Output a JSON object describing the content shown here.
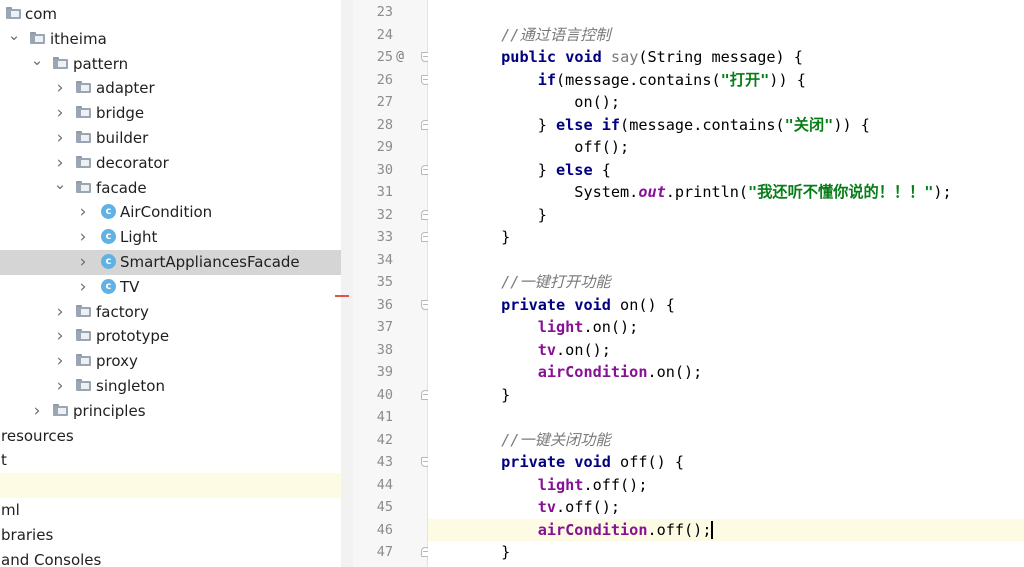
{
  "project_tree": {
    "items": [
      {
        "label": "com",
        "type": "folder",
        "expanded": true,
        "arrow": false,
        "indent": 0
      },
      {
        "label": "itheima",
        "type": "folder",
        "expanded": true,
        "arrow": true,
        "indent": 1
      },
      {
        "label": "pattern",
        "type": "folder",
        "expanded": true,
        "arrow": true,
        "indent": 2
      },
      {
        "label": "adapter",
        "type": "folder",
        "expanded": false,
        "arrow": true,
        "indent": 3
      },
      {
        "label": "bridge",
        "type": "folder",
        "expanded": false,
        "arrow": true,
        "indent": 3
      },
      {
        "label": "builder",
        "type": "folder",
        "expanded": false,
        "arrow": true,
        "indent": 3
      },
      {
        "label": "decorator",
        "type": "folder",
        "expanded": false,
        "arrow": true,
        "indent": 3
      },
      {
        "label": "facade",
        "type": "folder",
        "expanded": true,
        "arrow": true,
        "indent": 3
      },
      {
        "label": "AirCondition",
        "type": "class",
        "expanded": false,
        "arrow": true,
        "indent": 4
      },
      {
        "label": "Light",
        "type": "class",
        "expanded": false,
        "arrow": true,
        "indent": 4
      },
      {
        "label": "SmartAppliancesFacade",
        "type": "class",
        "expanded": false,
        "arrow": true,
        "indent": 4,
        "selected": true
      },
      {
        "label": "TV",
        "type": "class",
        "expanded": false,
        "arrow": true,
        "indent": 4
      },
      {
        "label": "factory",
        "type": "folder",
        "expanded": false,
        "arrow": true,
        "indent": 3
      },
      {
        "label": "prototype",
        "type": "folder",
        "expanded": false,
        "arrow": true,
        "indent": 3
      },
      {
        "label": "proxy",
        "type": "folder",
        "expanded": false,
        "arrow": true,
        "indent": 3
      },
      {
        "label": "singleton",
        "type": "folder",
        "expanded": false,
        "arrow": true,
        "indent": 3
      },
      {
        "label": "principles",
        "type": "folder",
        "expanded": false,
        "arrow": true,
        "indent": 2
      },
      {
        "label": "resources",
        "type": "text",
        "indent": -1
      },
      {
        "label": "t",
        "type": "text",
        "indent": -1
      },
      {
        "label": "",
        "type": "blank",
        "highlight": true
      },
      {
        "label": "ml",
        "type": "text",
        "indent": -1
      },
      {
        "label": "braries",
        "type": "text",
        "indent": -1
      },
      {
        "label": "and Consoles",
        "type": "text",
        "indent": -1
      }
    ],
    "class_icon_letter": "c",
    "selected_color": "#d5d5d5"
  },
  "editor": {
    "lines": [
      {
        "n": "23",
        "tokens": []
      },
      {
        "n": "24",
        "tokens": [
          {
            "t": "        "
          },
          {
            "t": "//通过语言控制",
            "c": "cm"
          }
        ]
      },
      {
        "n": "25",
        "mark": "@",
        "fold": "down",
        "tokens": [
          {
            "t": "        "
          },
          {
            "t": "public",
            "c": "kw"
          },
          {
            "t": " "
          },
          {
            "t": "void",
            "c": "kw"
          },
          {
            "t": " "
          },
          {
            "t": "say",
            "c": "mu"
          },
          {
            "t": "(String message) {"
          }
        ]
      },
      {
        "n": "26",
        "fold": "down",
        "tokens": [
          {
            "t": "            "
          },
          {
            "t": "if",
            "c": "kw"
          },
          {
            "t": "(message.contains("
          },
          {
            "t": "\"打开\"",
            "c": "st"
          },
          {
            "t": ")) {"
          }
        ]
      },
      {
        "n": "27",
        "tokens": [
          {
            "t": "                on();"
          }
        ]
      },
      {
        "n": "28",
        "fold": "up",
        "tokens": [
          {
            "t": "            } "
          },
          {
            "t": "else",
            "c": "kw"
          },
          {
            "t": " "
          },
          {
            "t": "if",
            "c": "kw"
          },
          {
            "t": "(message.contains("
          },
          {
            "t": "\"关闭\"",
            "c": "st"
          },
          {
            "t": ")) {"
          }
        ]
      },
      {
        "n": "29",
        "tokens": [
          {
            "t": "                off();"
          }
        ]
      },
      {
        "n": "30",
        "fold": "up",
        "tokens": [
          {
            "t": "            } "
          },
          {
            "t": "else",
            "c": "kw"
          },
          {
            "t": " {"
          }
        ]
      },
      {
        "n": "31",
        "tokens": [
          {
            "t": "                System."
          },
          {
            "t": "out",
            "c": "sf"
          },
          {
            "t": ".println("
          },
          {
            "t": "\"我还听不懂你说的！！！\"",
            "c": "st"
          },
          {
            "t": ");"
          }
        ]
      },
      {
        "n": "32",
        "fold": "up",
        "tokens": [
          {
            "t": "            }"
          }
        ]
      },
      {
        "n": "33",
        "fold": "up",
        "tokens": [
          {
            "t": "        }"
          }
        ]
      },
      {
        "n": "34",
        "tokens": []
      },
      {
        "n": "35",
        "tokens": [
          {
            "t": "        "
          },
          {
            "t": "//一键打开功能",
            "c": "cm"
          }
        ]
      },
      {
        "n": "36",
        "fold": "down",
        "tokens": [
          {
            "t": "        "
          },
          {
            "t": "private",
            "c": "kw"
          },
          {
            "t": " "
          },
          {
            "t": "void",
            "c": "kw"
          },
          {
            "t": " on() {"
          }
        ]
      },
      {
        "n": "37",
        "tokens": [
          {
            "t": "            "
          },
          {
            "t": "light",
            "c": "fd"
          },
          {
            "t": ".on();"
          }
        ]
      },
      {
        "n": "38",
        "tokens": [
          {
            "t": "            "
          },
          {
            "t": "tv",
            "c": "fd"
          },
          {
            "t": ".on();"
          }
        ]
      },
      {
        "n": "39",
        "tokens": [
          {
            "t": "            "
          },
          {
            "t": "airCondition",
            "c": "fd"
          },
          {
            "t": ".on();"
          }
        ]
      },
      {
        "n": "40",
        "fold": "up",
        "tokens": [
          {
            "t": "        }"
          }
        ]
      },
      {
        "n": "41",
        "tokens": []
      },
      {
        "n": "42",
        "tokens": [
          {
            "t": "        "
          },
          {
            "t": "//一键关闭功能",
            "c": "cm"
          }
        ]
      },
      {
        "n": "43",
        "fold": "down",
        "tokens": [
          {
            "t": "        "
          },
          {
            "t": "private",
            "c": "kw"
          },
          {
            "t": " "
          },
          {
            "t": "void",
            "c": "kw"
          },
          {
            "t": " off() {"
          }
        ]
      },
      {
        "n": "44",
        "tokens": [
          {
            "t": "            "
          },
          {
            "t": "light",
            "c": "fd"
          },
          {
            "t": ".off();"
          }
        ]
      },
      {
        "n": "45",
        "tokens": [
          {
            "t": "            "
          },
          {
            "t": "tv",
            "c": "fd"
          },
          {
            "t": ".off();"
          }
        ]
      },
      {
        "n": "46",
        "current": true,
        "caret": true,
        "tokens": [
          {
            "t": "            "
          },
          {
            "t": "airCondition",
            "c": "fd"
          },
          {
            "t": ".off();"
          }
        ]
      },
      {
        "n": "47",
        "fold": "up",
        "tokens": [
          {
            "t": "        }"
          }
        ]
      }
    ],
    "current_line_color": "#fdfbe3"
  }
}
